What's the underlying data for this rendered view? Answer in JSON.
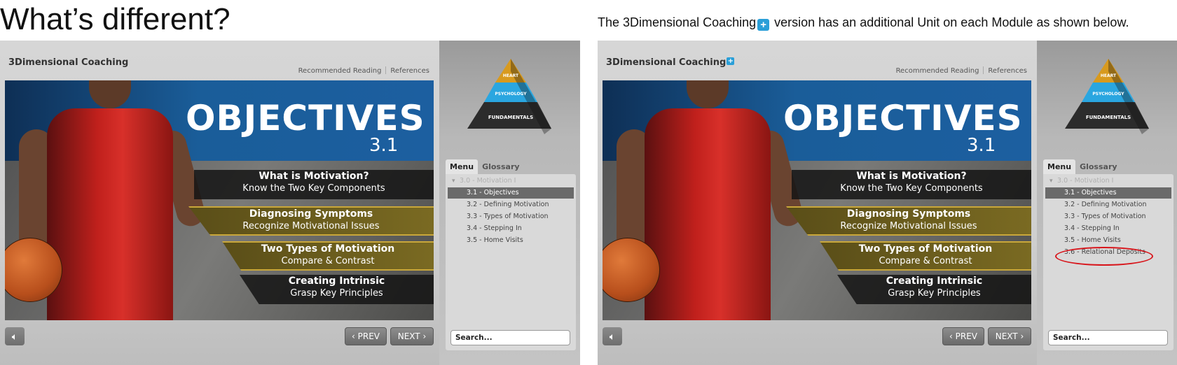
{
  "heading": "What’s different?",
  "caption": {
    "before": "The 3Dimensional Coaching",
    "after": " version has an additional Unit on each Module as shown below.",
    "plus_symbol": "+"
  },
  "course_title": "3Dimensional Coaching",
  "top_links": [
    "Recommended Reading",
    "References"
  ],
  "slide": {
    "title": "OBJECTIVES",
    "number": "3.1",
    "bands": [
      {
        "title": "What is Motivation?",
        "subtitle": "Know the Two Key Components"
      },
      {
        "title": "Diagnosing Symptoms",
        "subtitle": "Recognize Motivational Issues"
      },
      {
        "title": "Two Types of Motivation",
        "subtitle": "Compare & Contrast"
      },
      {
        "title": "Creating Intrinsic",
        "subtitle": "Grasp Key Principles"
      }
    ]
  },
  "controls": {
    "prev": "PREV",
    "next": "NEXT"
  },
  "pyramid": {
    "top": "HEART",
    "middle": "PSYCHOLOGY",
    "bottom": "FUNDAMENTALS"
  },
  "tabs": {
    "menu": "Menu",
    "glossary": "Glossary"
  },
  "menu_left": [
    "3.0 - Motivation I",
    "3.1 - Objectives",
    "3.2 - Defining Motivation",
    "3.3 - Types of Motivation",
    "3.4 - Stepping In",
    "3.5 - Home Visits"
  ],
  "menu_right": [
    "3.0 - Motivation I",
    "3.1 - Objectives",
    "3.2 - Defining Motivation",
    "3.3 - Types of Motivation",
    "3.4 - Stepping In",
    "3.5 - Home Visits",
    "3.6 - Relational Deposits"
  ],
  "search_placeholder": "Search...",
  "colors": {
    "accent_plus": "#2a9fd8",
    "highlight": "#d8151b",
    "selected_item": "#6a6a6a"
  }
}
